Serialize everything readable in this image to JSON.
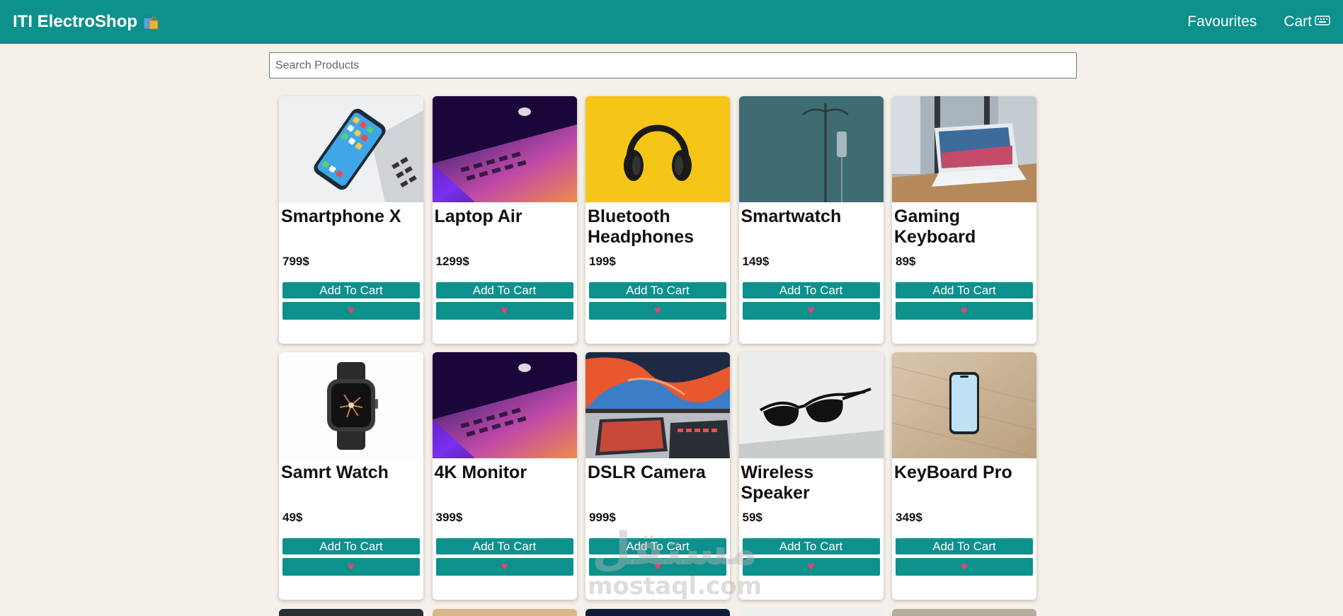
{
  "navbar": {
    "brand": "ITI ElectroShop",
    "brand_icon": "shopping-bags-icon",
    "links": [
      {
        "label": "Favourites"
      },
      {
        "label": "Cart",
        "icon": "keyboard-icon"
      }
    ],
    "background": "#0d918c"
  },
  "search": {
    "placeholder": "Search Products",
    "value": ""
  },
  "products": [
    {
      "title": "Smartphone X",
      "price": "799$",
      "cart_label": "Add To Cart",
      "fav_icon": "heart-icon",
      "image": "smartphone-photo"
    },
    {
      "title": "Laptop Air",
      "price": "1299$",
      "cart_label": "Add To Cart",
      "fav_icon": "heart-icon",
      "image": "laptop-photo"
    },
    {
      "title": "Bluetooth Headphones",
      "price": "199$",
      "cart_label": "Add To Cart",
      "fav_icon": "heart-icon",
      "image": "headphones-photo"
    },
    {
      "title": "Smartwatch",
      "price": "149$",
      "cart_label": "Add To Cart",
      "fav_icon": "heart-icon",
      "image": "iv-stand-photo"
    },
    {
      "title": "Gaming Keyboard",
      "price": "89$",
      "cart_label": "Add To Cart",
      "fav_icon": "heart-icon",
      "image": "laptop-desk-photo"
    },
    {
      "title": "Samrt Watch",
      "price": "49$",
      "cart_label": "Add To Cart",
      "fav_icon": "heart-icon",
      "image": "smartwatch-photo"
    },
    {
      "title": "4K Monitor",
      "price": "399$",
      "cart_label": "Add To Cart",
      "fav_icon": "heart-icon",
      "image": "laptop-photo"
    },
    {
      "title": "DSLR Camera",
      "price": "999$",
      "cart_label": "Add To Cart",
      "fav_icon": "heart-icon",
      "image": "monitor-photo"
    },
    {
      "title": "Wireless Speaker",
      "price": "59$",
      "cart_label": "Add To Cart",
      "fav_icon": "heart-icon",
      "image": "sunglasses-photo"
    },
    {
      "title": "KeyBoard Pro",
      "price": "349$",
      "cart_label": "Add To Cart",
      "fav_icon": "heart-icon",
      "image": "phone-on-wood-photo"
    }
  ],
  "watermark": {
    "arabic": "مستقل",
    "latin": "mostaql.com"
  },
  "colors": {
    "accent": "#0d918c",
    "background": "#f5f0ea",
    "heart": "#ff3d6e"
  }
}
